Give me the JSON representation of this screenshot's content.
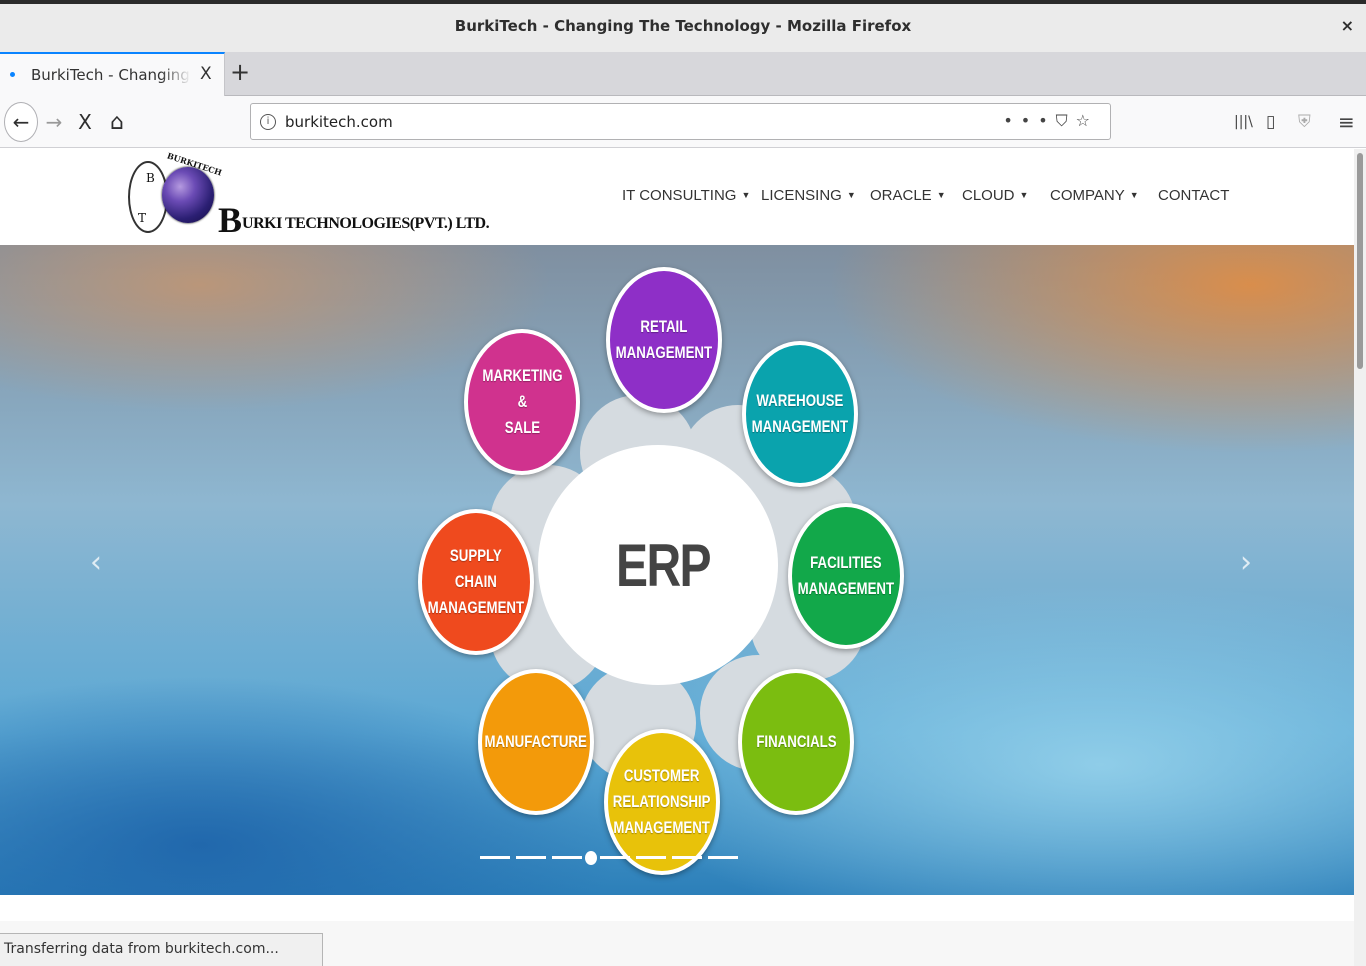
{
  "window": {
    "title": "BurkiTech - Changing The Technology - Mozilla Firefox",
    "close_glyph": "×"
  },
  "tabs": {
    "active_label": "BurkiTech - Changing The Technology",
    "close_glyph": "X",
    "new_tab_glyph": "+"
  },
  "toolbar": {
    "back_glyph": "←",
    "forward_glyph": "→",
    "stop_glyph": "X",
    "home_glyph": "⌂",
    "url": "burkitech.com",
    "info_glyph": "i",
    "page_actions_glyph": "•••",
    "pocket_glyph": "⛉",
    "bookmark_glyph": "☆",
    "library_glyph": "|||\\",
    "sidebar_glyph": "▯",
    "shield_glyph": "⛨",
    "menu_glyph": "≡"
  },
  "site": {
    "logo": {
      "big_letter": "B",
      "name_rest": "URKI TECHNOLOGIES(PVT.) LTD.",
      "arc_text": "BURKITECH",
      "emblem_letters": [
        "B",
        "T"
      ]
    },
    "menu": [
      {
        "label": "IT CONSULTING",
        "has_caret": true
      },
      {
        "label": "LICENSING",
        "has_caret": true
      },
      {
        "label": "ORACLE",
        "has_caret": true
      },
      {
        "label": "CLOUD",
        "has_caret": true
      },
      {
        "label": "COMPANY",
        "has_caret": true
      },
      {
        "label": "CONTACT",
        "has_caret": false
      }
    ],
    "caret_glyph": "▼",
    "carousel": {
      "prev_glyph": "‹",
      "next_glyph": "›",
      "center": "ERP",
      "nodes": [
        {
          "label": "RETAIL\nMANAGEMENT",
          "color": "#8e2fc7"
        },
        {
          "label": "WAREHOUSE\nMANAGEMENT",
          "color": "#0aa3ad"
        },
        {
          "label": "FACILITIES\nMANAGEMENT",
          "color": "#12a84a"
        },
        {
          "label": "FINANCIALS",
          "color": "#7bbd10"
        },
        {
          "label": "CUSTOMER\nRELATIONSHIP\nMANAGEMENT",
          "color": "#e8c20a"
        },
        {
          "label": "MANUFACTURE",
          "color": "#f39a0a"
        },
        {
          "label": "SUPPLY CHAIN\nMANAGEMENT",
          "color": "#ef4a1e"
        },
        {
          "label": "MARKETING\n&\nSALE",
          "color": "#d0328e"
        }
      ],
      "slide_count": 8,
      "active_slide": 4
    }
  },
  "status": {
    "text": "Transferring data from burkitech.com..."
  }
}
